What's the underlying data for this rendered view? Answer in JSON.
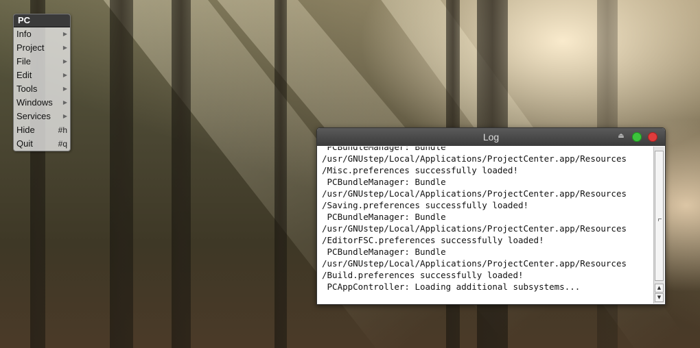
{
  "menu": {
    "title": "PC",
    "items": [
      {
        "label": "Info",
        "submenu": true
      },
      {
        "label": "Project",
        "submenu": true
      },
      {
        "label": "File",
        "submenu": true
      },
      {
        "label": "Edit",
        "submenu": true
      },
      {
        "label": "Tools",
        "submenu": true
      },
      {
        "label": "Windows",
        "submenu": true
      },
      {
        "label": "Services",
        "submenu": true
      },
      {
        "label": "Hide",
        "shortcut": "#h"
      },
      {
        "label": "Quit",
        "shortcut": "#q"
      }
    ],
    "submenu_arrow": "▶"
  },
  "log_window": {
    "title": "Log",
    "minimize_glyph": "⏏",
    "lines": [
      " PCBundleManager: Bundle",
      "/usr/GNUstep/Local/Applications/ProjectCenter.app/Resources",
      "/Misc.preferences successfully loaded!",
      " PCBundleManager: Bundle",
      "/usr/GNUstep/Local/Applications/ProjectCenter.app/Resources",
      "/Saving.preferences successfully loaded!",
      " PCBundleManager: Bundle",
      "/usr/GNUstep/Local/Applications/ProjectCenter.app/Resources",
      "/EditorFSC.preferences successfully loaded!",
      " PCBundleManager: Bundle",
      "/usr/GNUstep/Local/Applications/ProjectCenter.app/Resources",
      "/Build.preferences successfully loaded!",
      " PCAppController: Loading additional subsystems..."
    ],
    "scroll_up_glyph": "▲",
    "scroll_down_glyph": "▼"
  },
  "colors": {
    "zoom_button": "#3cc43c",
    "close_button": "#e03c3c",
    "titlebar": "#3b3b3b"
  }
}
